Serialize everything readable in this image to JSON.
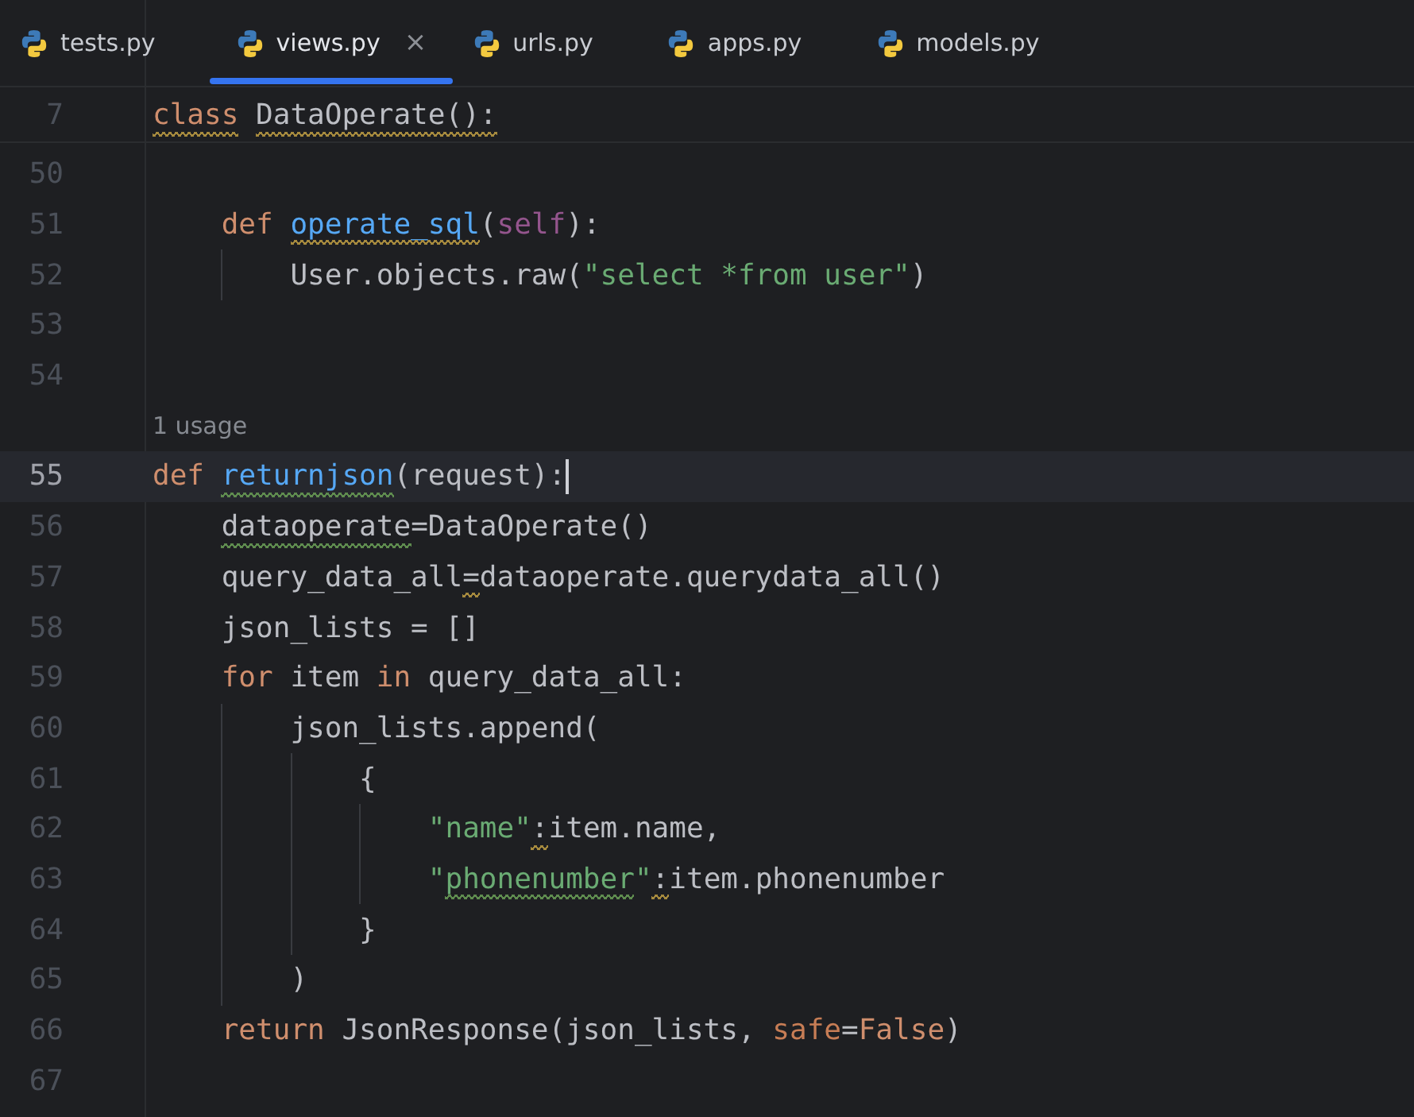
{
  "tabs": [
    {
      "label": "tests.py",
      "selected": false
    },
    {
      "label": "views.py",
      "selected": true,
      "close": "×"
    },
    {
      "label": "urls.py",
      "selected": false
    },
    {
      "label": "apps.py",
      "selected": false
    },
    {
      "label": "models.py",
      "selected": false
    }
  ],
  "sticky_line": {
    "number": "7",
    "tokens": [
      {
        "text": "class",
        "kind": "keyword",
        "warning": true
      },
      {
        "text": " DataOperate():",
        "kind": "plain",
        "warning": true
      }
    ]
  },
  "lines": [
    {
      "kind": "code",
      "number": "50",
      "current": false
    },
    {
      "kind": "code",
      "number": "51",
      "current": false,
      "tokens": [
        {
          "text": "    def ",
          "kind": "keyword"
        },
        {
          "text": "operate_sql",
          "kind": "function",
          "warning": true
        },
        {
          "text": "(",
          "kind": "plain"
        },
        {
          "text": "self",
          "kind": "self"
        },
        {
          "text": "):",
          "kind": "plain"
        }
      ]
    },
    {
      "kind": "code",
      "number": "52",
      "current": false,
      "tokens": [
        {
          "text": "        User.objects.raw(",
          "kind": "plain"
        },
        {
          "text": "\"select *from user\"",
          "kind": "string"
        },
        {
          "text": ")",
          "kind": "plain"
        }
      ]
    },
    {
      "kind": "code",
      "number": "53",
      "current": false
    },
    {
      "kind": "code",
      "number": "54",
      "current": false
    },
    {
      "kind": "hint",
      "text": "1 usage"
    },
    {
      "kind": "code",
      "number": "55",
      "current": true,
      "tokens": [
        {
          "text": "def ",
          "kind": "keyword"
        },
        {
          "text": "returnjson",
          "kind": "function",
          "typo": true
        },
        {
          "text": "(request):",
          "kind": "plain"
        }
      ]
    },
    {
      "kind": "code",
      "number": "56",
      "current": false,
      "tokens": [
        {
          "text": "    dataoperate",
          "kind": "plain",
          "typo": true
        },
        {
          "text": "=DataOperate()",
          "kind": "plain"
        }
      ]
    },
    {
      "kind": "code",
      "number": "57",
      "current": false,
      "tokens": [
        {
          "text": "    query_data_all",
          "kind": "plain"
        },
        {
          "text": "=",
          "kind": "plain",
          "warning": true
        },
        {
          "text": "dataoperate.querydata_all()",
          "kind": "plain"
        }
      ]
    },
    {
      "kind": "code",
      "number": "58",
      "current": false,
      "tokens": [
        {
          "text": "    json_lists = []",
          "kind": "plain"
        }
      ]
    },
    {
      "kind": "code",
      "number": "59",
      "current": false,
      "tokens": [
        {
          "text": "    for",
          "kind": "keyword"
        },
        {
          "text": " item ",
          "kind": "plain"
        },
        {
          "text": "in",
          "kind": "keyword"
        },
        {
          "text": " query_data_all:",
          "kind": "plain"
        }
      ]
    },
    {
      "kind": "code",
      "number": "60",
      "current": false,
      "tokens": [
        {
          "text": "        json_lists.append(",
          "kind": "plain"
        }
      ]
    },
    {
      "kind": "code",
      "number": "61",
      "current": false,
      "tokens": [
        {
          "text": "            {",
          "kind": "plain"
        }
      ]
    },
    {
      "kind": "code",
      "number": "62",
      "current": false,
      "tokens": [
        {
          "text": "                \"name\"",
          "kind": "string"
        },
        {
          "text": ":",
          "kind": "plain",
          "warning": true
        },
        {
          "text": "item.name,",
          "kind": "plain"
        }
      ]
    },
    {
      "kind": "code",
      "number": "63",
      "current": false,
      "tokens": [
        {
          "text": "                \"",
          "kind": "string"
        },
        {
          "text": "phonenumber",
          "kind": "string",
          "typo": true
        },
        {
          "text": "\"",
          "kind": "string"
        },
        {
          "text": ":",
          "kind": "plain",
          "warning": true
        },
        {
          "text": "item.phonenumber",
          "kind": "plain"
        }
      ]
    },
    {
      "kind": "code",
      "number": "64",
      "current": false,
      "tokens": [
        {
          "text": "            }",
          "kind": "plain"
        }
      ]
    },
    {
      "kind": "code",
      "number": "65",
      "current": false,
      "tokens": [
        {
          "text": "        )",
          "kind": "plain"
        }
      ]
    },
    {
      "kind": "code",
      "number": "66",
      "current": false,
      "tokens": [
        {
          "text": "    return",
          "kind": "keyword"
        },
        {
          "text": " JsonResponse(json_lists, ",
          "kind": "plain"
        },
        {
          "text": "safe",
          "kind": "param"
        },
        {
          "text": "=",
          "kind": "plain"
        },
        {
          "text": "False",
          "kind": "keyword"
        },
        {
          "text": ")",
          "kind": "plain"
        }
      ]
    },
    {
      "kind": "code",
      "number": "67",
      "current": false
    }
  ]
}
